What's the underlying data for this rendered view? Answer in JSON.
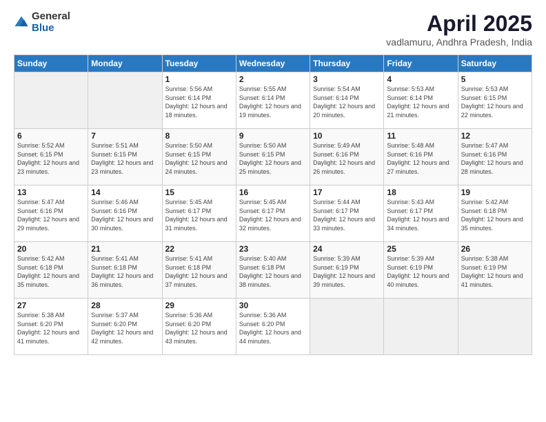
{
  "logo": {
    "general": "General",
    "blue": "Blue"
  },
  "title": "April 2025",
  "subtitle": "vadlamuru, Andhra Pradesh, India",
  "weekdays": [
    "Sunday",
    "Monday",
    "Tuesday",
    "Wednesday",
    "Thursday",
    "Friday",
    "Saturday"
  ],
  "weeks": [
    [
      {
        "day": "",
        "info": ""
      },
      {
        "day": "",
        "info": ""
      },
      {
        "day": "1",
        "info": "Sunrise: 5:56 AM\nSunset: 6:14 PM\nDaylight: 12 hours and 18 minutes."
      },
      {
        "day": "2",
        "info": "Sunrise: 5:55 AM\nSunset: 6:14 PM\nDaylight: 12 hours and 19 minutes."
      },
      {
        "day": "3",
        "info": "Sunrise: 5:54 AM\nSunset: 6:14 PM\nDaylight: 12 hours and 20 minutes."
      },
      {
        "day": "4",
        "info": "Sunrise: 5:53 AM\nSunset: 6:14 PM\nDaylight: 12 hours and 21 minutes."
      },
      {
        "day": "5",
        "info": "Sunrise: 5:53 AM\nSunset: 6:15 PM\nDaylight: 12 hours and 22 minutes."
      }
    ],
    [
      {
        "day": "6",
        "info": "Sunrise: 5:52 AM\nSunset: 6:15 PM\nDaylight: 12 hours and 23 minutes."
      },
      {
        "day": "7",
        "info": "Sunrise: 5:51 AM\nSunset: 6:15 PM\nDaylight: 12 hours and 23 minutes."
      },
      {
        "day": "8",
        "info": "Sunrise: 5:50 AM\nSunset: 6:15 PM\nDaylight: 12 hours and 24 minutes."
      },
      {
        "day": "9",
        "info": "Sunrise: 5:50 AM\nSunset: 6:15 PM\nDaylight: 12 hours and 25 minutes."
      },
      {
        "day": "10",
        "info": "Sunrise: 5:49 AM\nSunset: 6:16 PM\nDaylight: 12 hours and 26 minutes."
      },
      {
        "day": "11",
        "info": "Sunrise: 5:48 AM\nSunset: 6:16 PM\nDaylight: 12 hours and 27 minutes."
      },
      {
        "day": "12",
        "info": "Sunrise: 5:47 AM\nSunset: 6:16 PM\nDaylight: 12 hours and 28 minutes."
      }
    ],
    [
      {
        "day": "13",
        "info": "Sunrise: 5:47 AM\nSunset: 6:16 PM\nDaylight: 12 hours and 29 minutes."
      },
      {
        "day": "14",
        "info": "Sunrise: 5:46 AM\nSunset: 6:16 PM\nDaylight: 12 hours and 30 minutes."
      },
      {
        "day": "15",
        "info": "Sunrise: 5:45 AM\nSunset: 6:17 PM\nDaylight: 12 hours and 31 minutes."
      },
      {
        "day": "16",
        "info": "Sunrise: 5:45 AM\nSunset: 6:17 PM\nDaylight: 12 hours and 32 minutes."
      },
      {
        "day": "17",
        "info": "Sunrise: 5:44 AM\nSunset: 6:17 PM\nDaylight: 12 hours and 33 minutes."
      },
      {
        "day": "18",
        "info": "Sunrise: 5:43 AM\nSunset: 6:17 PM\nDaylight: 12 hours and 34 minutes."
      },
      {
        "day": "19",
        "info": "Sunrise: 5:42 AM\nSunset: 6:18 PM\nDaylight: 12 hours and 35 minutes."
      }
    ],
    [
      {
        "day": "20",
        "info": "Sunrise: 5:42 AM\nSunset: 6:18 PM\nDaylight: 12 hours and 35 minutes."
      },
      {
        "day": "21",
        "info": "Sunrise: 5:41 AM\nSunset: 6:18 PM\nDaylight: 12 hours and 36 minutes."
      },
      {
        "day": "22",
        "info": "Sunrise: 5:41 AM\nSunset: 6:18 PM\nDaylight: 12 hours and 37 minutes."
      },
      {
        "day": "23",
        "info": "Sunrise: 5:40 AM\nSunset: 6:18 PM\nDaylight: 12 hours and 38 minutes."
      },
      {
        "day": "24",
        "info": "Sunrise: 5:39 AM\nSunset: 6:19 PM\nDaylight: 12 hours and 39 minutes."
      },
      {
        "day": "25",
        "info": "Sunrise: 5:39 AM\nSunset: 6:19 PM\nDaylight: 12 hours and 40 minutes."
      },
      {
        "day": "26",
        "info": "Sunrise: 5:38 AM\nSunset: 6:19 PM\nDaylight: 12 hours and 41 minutes."
      }
    ],
    [
      {
        "day": "27",
        "info": "Sunrise: 5:38 AM\nSunset: 6:20 PM\nDaylight: 12 hours and 41 minutes."
      },
      {
        "day": "28",
        "info": "Sunrise: 5:37 AM\nSunset: 6:20 PM\nDaylight: 12 hours and 42 minutes."
      },
      {
        "day": "29",
        "info": "Sunrise: 5:36 AM\nSunset: 6:20 PM\nDaylight: 12 hours and 43 minutes."
      },
      {
        "day": "30",
        "info": "Sunrise: 5:36 AM\nSunset: 6:20 PM\nDaylight: 12 hours and 44 minutes."
      },
      {
        "day": "",
        "info": ""
      },
      {
        "day": "",
        "info": ""
      },
      {
        "day": "",
        "info": ""
      }
    ]
  ]
}
